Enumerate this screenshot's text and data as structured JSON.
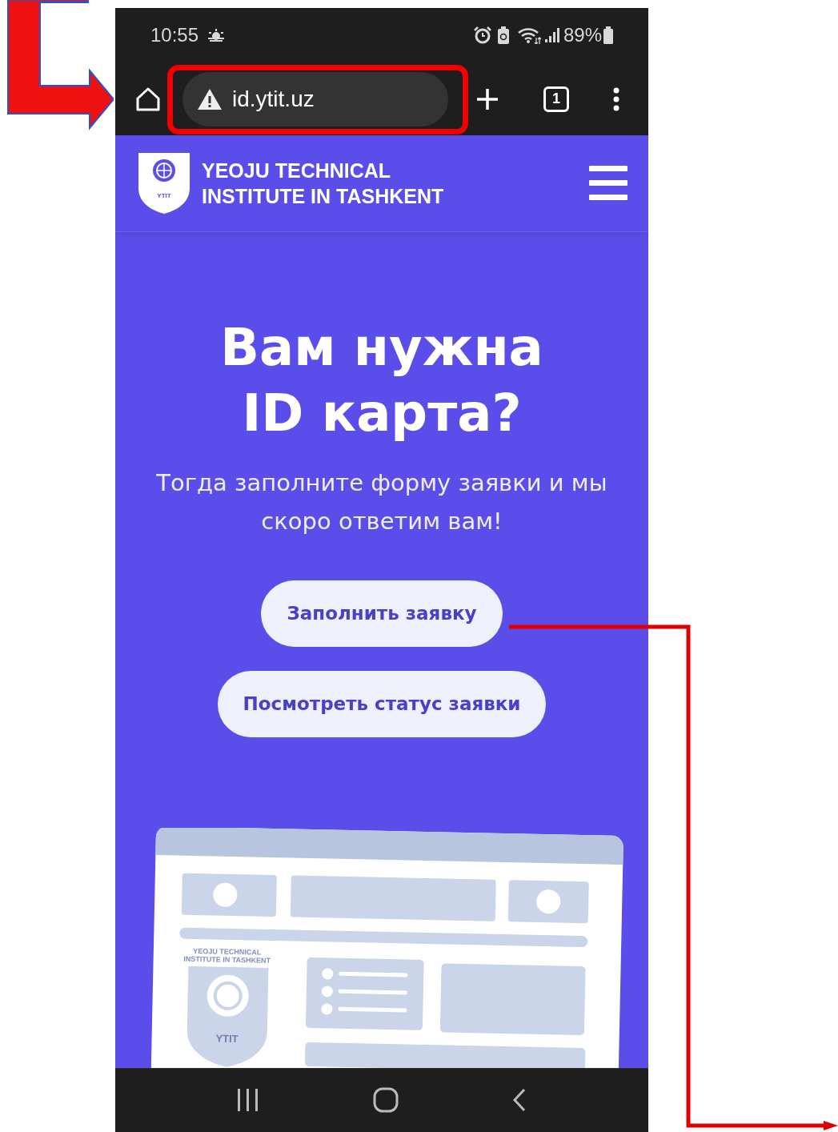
{
  "status_bar": {
    "time": "10:55",
    "battery": "89%"
  },
  "browser": {
    "url": "id.ytit.uz",
    "tab_count": "1"
  },
  "site_header": {
    "logo_text": "YTIT",
    "title_lines": [
      "YEOJU TECHNICAL",
      "INSTITUTE IN TASHKENT"
    ]
  },
  "hero": {
    "heading_lines": [
      "Вам нужна",
      "ID карта?"
    ],
    "subtitle": "Тогда заполните форму заявки и мы скоро ответим вам!",
    "buttons": [
      "Заполнить заявку",
      "Посмотреть статус заявки"
    ]
  },
  "illustration": {
    "caption_lines": [
      "YEOJU TECHNICAL",
      "INSTITUTE IN TASHKENT"
    ],
    "badge_text": "YTIT"
  }
}
